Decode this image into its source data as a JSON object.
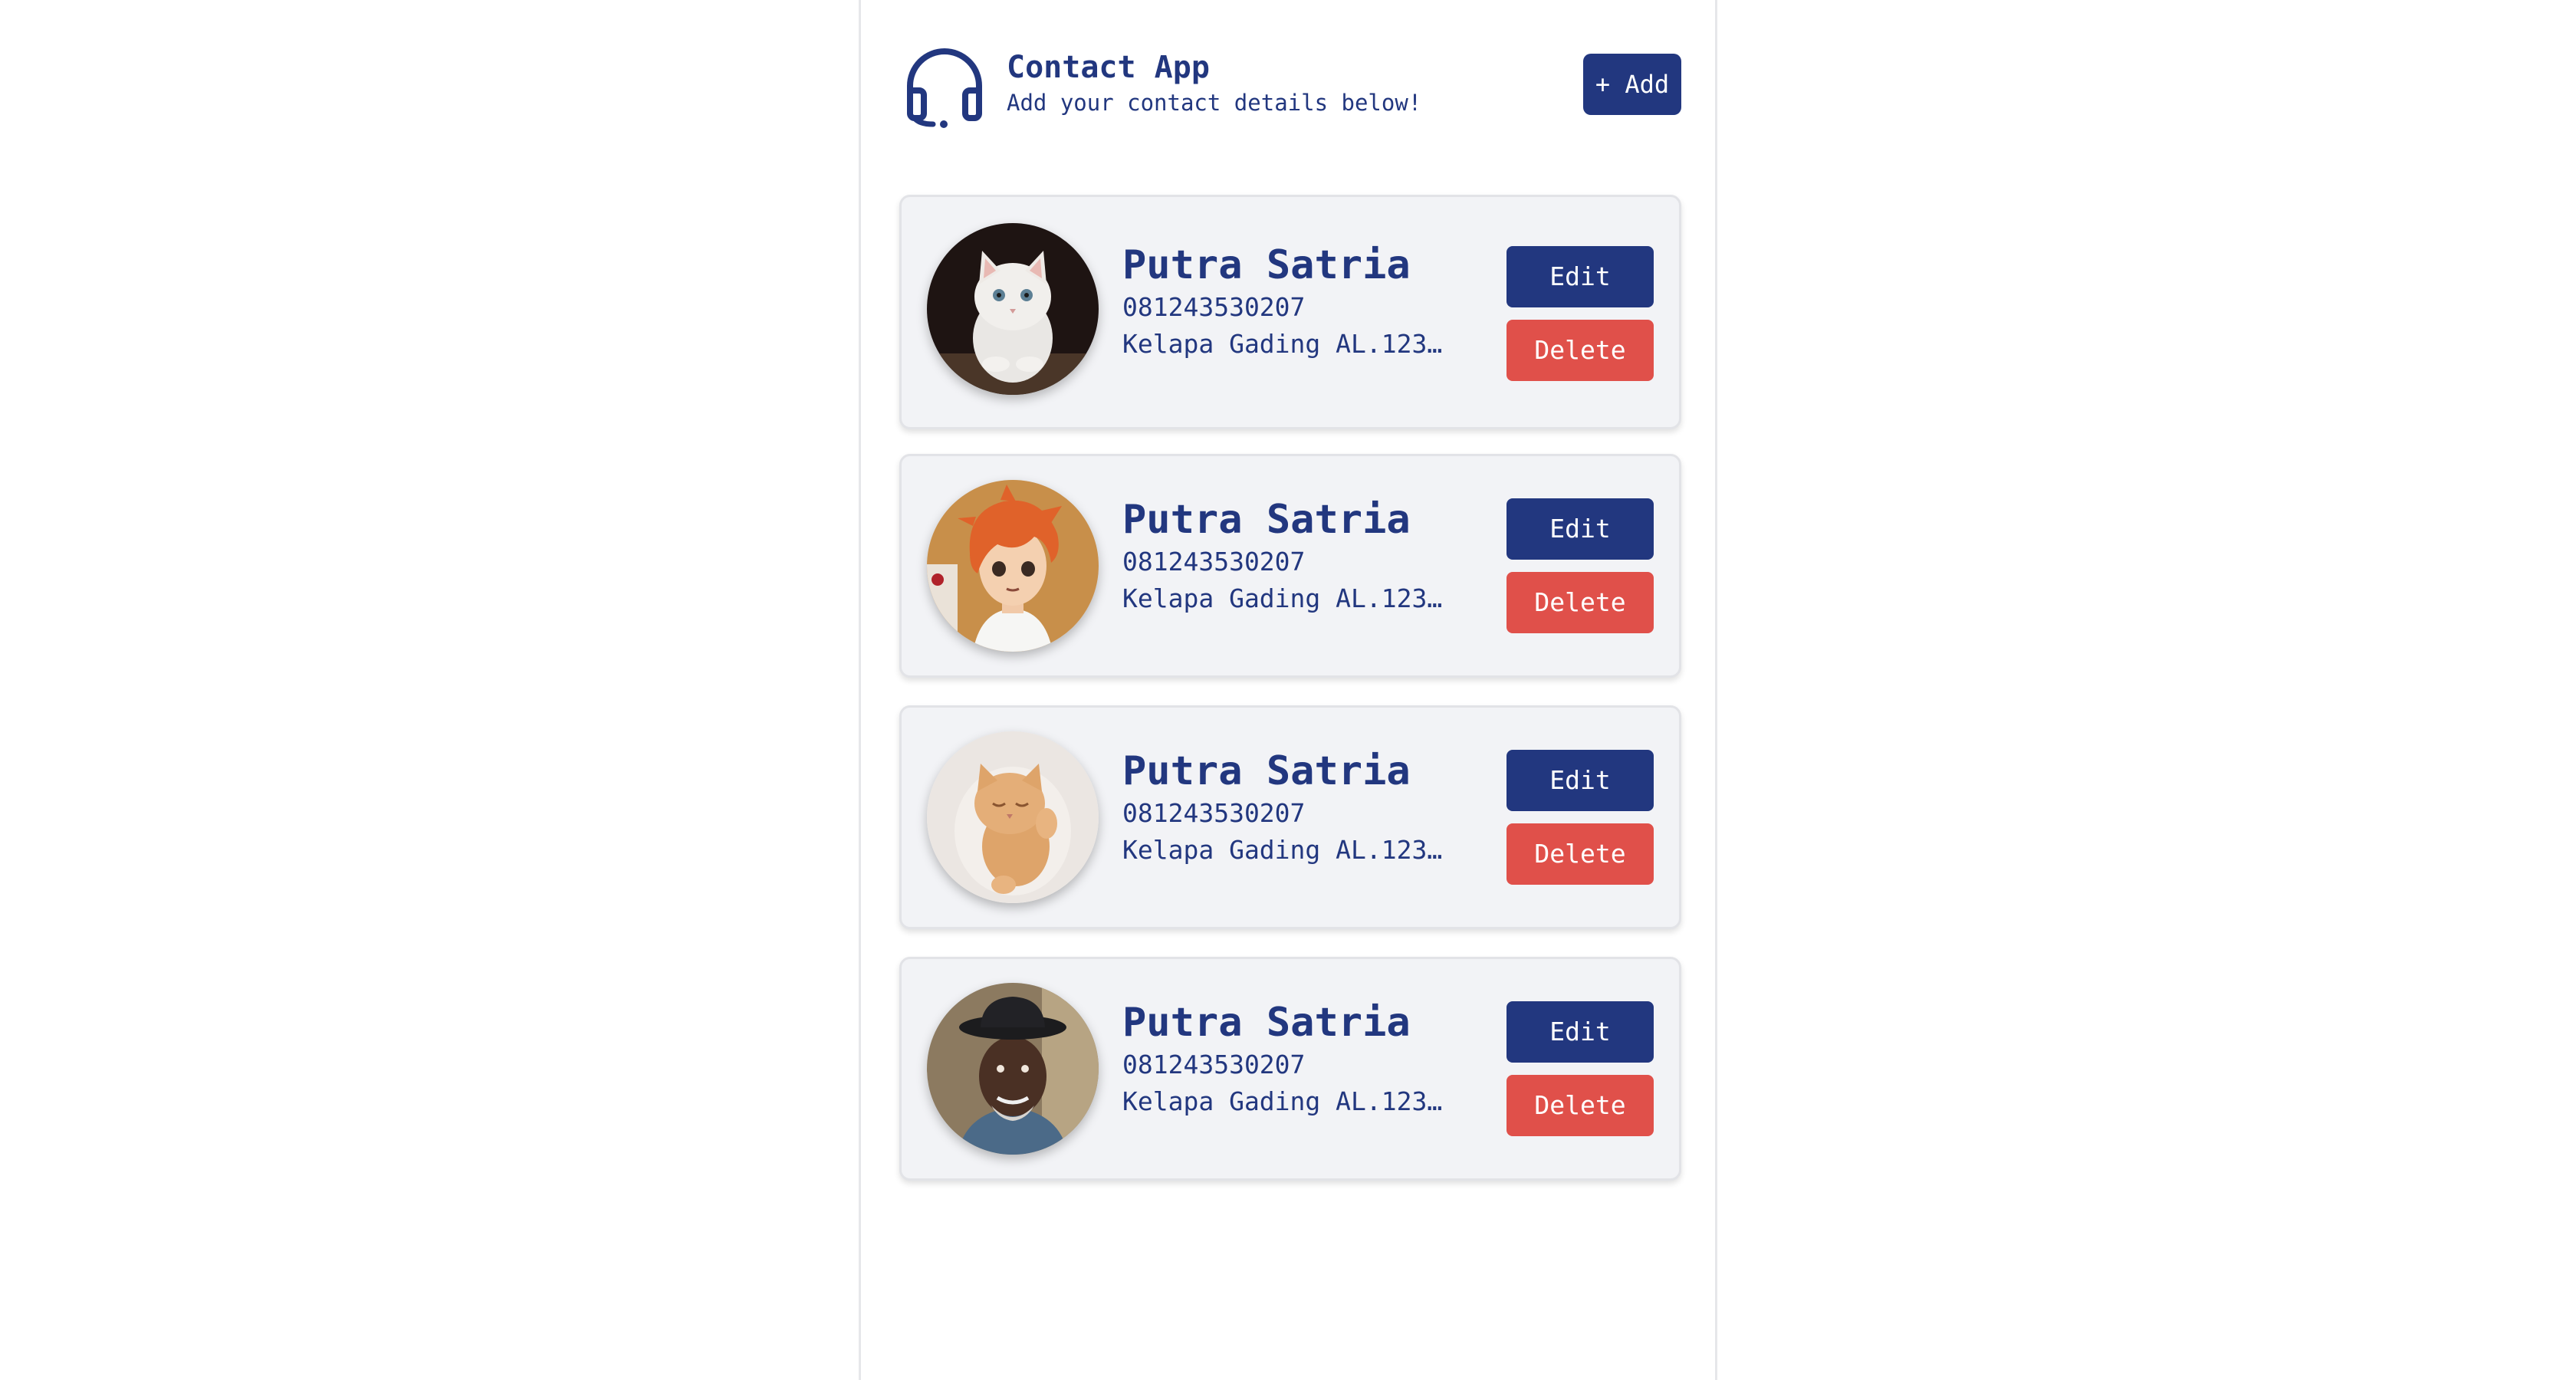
{
  "header": {
    "title": "Contact App",
    "subtitle": "Add your contact details below!",
    "add_label": "+ Add",
    "logo_icon": "headset-icon"
  },
  "theme": {
    "primary": "#22377f",
    "danger": "#e0504a",
    "card_bg": "#f2f3f6"
  },
  "contacts": [
    {
      "name": "Putra Satria",
      "phone": "081243530207",
      "address": "Kelapa Gading AL.123…",
      "avatar": "kitten-photo",
      "edit_label": "Edit",
      "delete_label": "Delete"
    },
    {
      "name": "Putra Satria",
      "phone": "081243530207",
      "address": "Kelapa Gading AL.123…",
      "avatar": "anime-boy-illustration",
      "edit_label": "Edit",
      "delete_label": "Delete"
    },
    {
      "name": "Putra Satria",
      "phone": "081243530207",
      "address": "Kelapa Gading AL.123…",
      "avatar": "sleeping-kitten-photo",
      "edit_label": "Edit",
      "delete_label": "Delete"
    },
    {
      "name": "Putra Satria",
      "phone": "081243530207",
      "address": "Kelapa Gading AL.123…",
      "avatar": "man-with-hat-photo",
      "edit_label": "Edit",
      "delete_label": "Delete"
    }
  ]
}
